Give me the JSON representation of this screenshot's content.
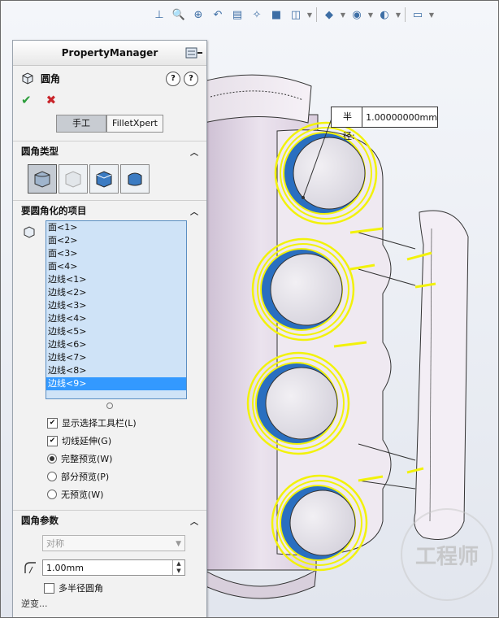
{
  "toolbar": {
    "icons": [
      "view-orientation-icon",
      "zoom-to-fit-icon",
      "zoom-area-icon",
      "previous-view-icon",
      "section-view-icon",
      "dynamic-annotation-icon",
      "display-style-icon",
      "hide-show-icon",
      "edit-appearance-icon",
      "apply-scene-icon",
      "view-settings-icon",
      "display-pane-icon"
    ]
  },
  "pm": {
    "title": "PropertyManager",
    "feature_name": "圆角",
    "tabs": [
      "手工",
      "FilletXpert"
    ],
    "active_tab": "手工",
    "sections": {
      "fillet_type": {
        "title": "圆角类型"
      },
      "items": {
        "title": "要圆角化的项目",
        "list": [
          "面<1>",
          "面<2>",
          "面<3>",
          "面<4>",
          "边线<1>",
          "边线<2>",
          "边线<3>",
          "边线<4>",
          "边线<5>",
          "边线<6>",
          "边线<7>",
          "边线<8>",
          "边线<9>"
        ],
        "selected": "边线<9>"
      },
      "options": {
        "show_toolbar": "显示选择工具栏(L)",
        "tangent_prop": "切线延伸(G)",
        "full_preview": "完整预览(W)",
        "partial_preview": "部分预览(P)",
        "no_preview": "无预览(W)"
      },
      "params": {
        "title": "圆角参数",
        "profile": "对称",
        "radius": "1.00mm",
        "multi_radius": "多半径圆角"
      }
    },
    "cut_label": "逆变..."
  },
  "dimension": {
    "label": "半径:",
    "value": "1.00000000mm"
  },
  "watermark": "工程师",
  "colors": {
    "accent": "#3399ff",
    "list_bg": "#cfe3f7",
    "highlight": "#f2f20a",
    "face_blue": "#2a6fc0"
  }
}
